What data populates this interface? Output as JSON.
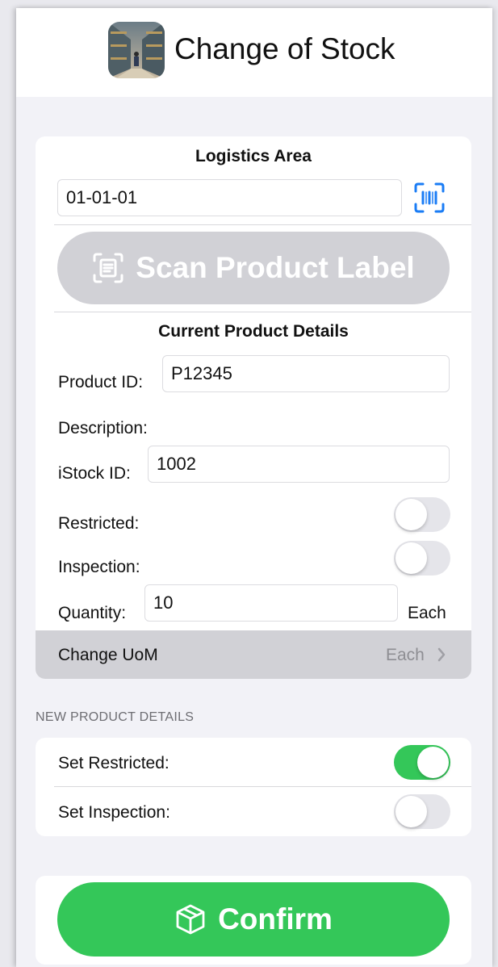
{
  "nav": {
    "title": "Change of Stock",
    "icon": "warehouse-app-icon"
  },
  "logistics": {
    "title": "Logistics Area",
    "value": "01-01-01",
    "barcode_icon": "barcode-viewfinder-icon"
  },
  "scan": {
    "label": "Scan Product Label",
    "icon": "document-viewfinder-icon",
    "enabled": false
  },
  "current": {
    "title": "Current Product Details",
    "product_id_label": "Product ID:",
    "product_id_value": "P12345",
    "description_label": "Description:",
    "istock_label": "iStock ID:",
    "istock_value": "1002",
    "restricted_label": "Restricted:",
    "restricted_on": false,
    "inspection_label": "Inspection:",
    "inspection_on": false,
    "quantity_label": "Quantity:",
    "quantity_value": "10",
    "quantity_unit": "Each",
    "change_uom_label": "Change UoM",
    "change_uom_value": "Each"
  },
  "new_details": {
    "header": "NEW PRODUCT DETAILS",
    "set_restricted_label": "Set Restricted:",
    "set_restricted_on": true,
    "set_inspection_label": "Set Inspection:",
    "set_inspection_on": false
  },
  "confirm": {
    "label": "Confirm",
    "icon": "cube-icon"
  },
  "colors": {
    "accent_green": "#34c759",
    "scan_blue": "#1a7cf5",
    "disabled_gray": "#d1d1d6",
    "background": "#f2f2f7"
  }
}
